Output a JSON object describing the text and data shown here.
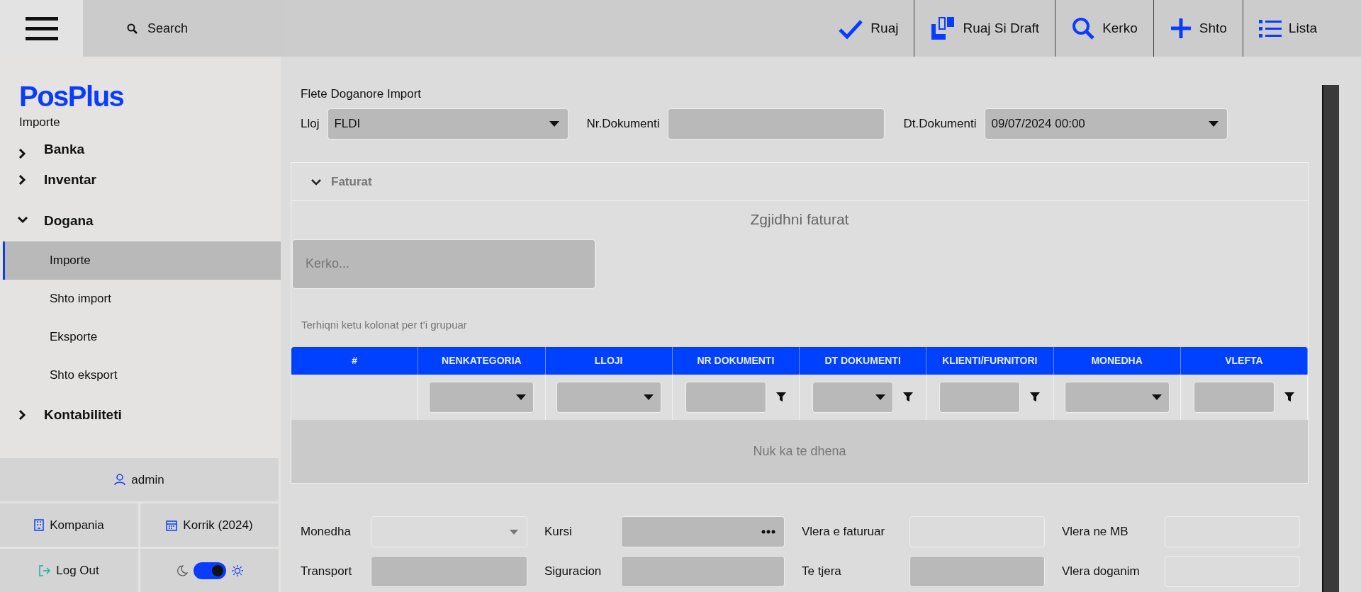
{
  "topbar": {
    "search_label": "Search",
    "actions": [
      {
        "kind": "check",
        "label": "Ruaj"
      },
      {
        "kind": "draft",
        "label": "Ruaj Si Draft"
      },
      {
        "kind": "search",
        "label": "Kerko"
      },
      {
        "kind": "plus",
        "label": "Shto"
      },
      {
        "kind": "list",
        "label": "Lista"
      }
    ]
  },
  "sidebar": {
    "brand": "PosPlus",
    "subtitle": "Importe",
    "items": [
      {
        "label": "Banka",
        "expanded": false
      },
      {
        "label": "Inventar",
        "expanded": false
      },
      {
        "label": "Dogana",
        "expanded": true,
        "children": [
          {
            "label": "Importe",
            "selected": true
          },
          {
            "label": "Shto import",
            "selected": false
          },
          {
            "label": "Eksporte",
            "selected": false
          },
          {
            "label": "Shto eksport",
            "selected": false
          }
        ]
      },
      {
        "label": "Kontabiliteti",
        "expanded": false
      }
    ],
    "user": "admin",
    "company": "Kompania",
    "period": "Korrik (2024)",
    "logout": "Log Out",
    "dark_mode": true
  },
  "form": {
    "title": "Flete Doganore Import",
    "fields": [
      {
        "kind": "select",
        "label": "Lloj",
        "value": "FLDI"
      },
      {
        "kind": "input",
        "label": "Nr.Dokumenti"
      },
      {
        "kind": "select",
        "label": "Dt.Dokumenti",
        "value": "09/07/2024 00:00"
      }
    ]
  },
  "invoices": {
    "title": "Faturat",
    "expanded": true,
    "heading": "Zgjidhni faturat",
    "search": {
      "placeholder": "Kerko..."
    },
    "group_hint": "Terhiqni ketu kolonat per t'i grupuar",
    "columns": [
      {
        "label": "#",
        "kind": "none"
      },
      {
        "label": "NENKATEGORIA",
        "kind": "select"
      },
      {
        "label": "LLOJI",
        "kind": "select"
      },
      {
        "label": "NR DOKUMENTI",
        "kind": "text"
      },
      {
        "label": "DT DOKUMENTI",
        "kind": "date"
      },
      {
        "label": "KLIENTI/FURNITORI",
        "kind": "text"
      },
      {
        "label": "MONEDHA",
        "kind": "select"
      },
      {
        "label": "VLEFTA",
        "kind": "text"
      }
    ],
    "empty_text": "Nuk ka te dhena"
  },
  "totals": [
    {
      "kind": "select",
      "label": "Monedha",
      "disabled": false
    },
    {
      "kind": "dots",
      "label": "Kursi",
      "disabled": true
    },
    {
      "kind": "input",
      "label": "Vlera e faturuar",
      "disabled": false
    },
    {
      "kind": "input",
      "label": "Vlera ne MB",
      "disabled": false
    },
    {
      "kind": "input",
      "label": "Transport",
      "disabled": true
    },
    {
      "kind": "input",
      "label": "Siguracion",
      "disabled": true
    },
    {
      "kind": "input",
      "label": "Te tjera",
      "disabled": true
    },
    {
      "kind": "input",
      "label": "Vlera doganim",
      "disabled": false
    }
  ]
}
